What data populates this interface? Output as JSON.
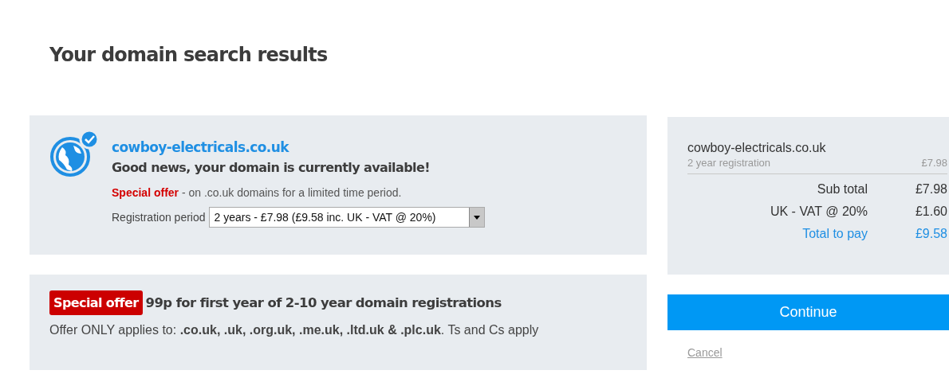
{
  "title": "Your domain search results",
  "result": {
    "domain": "cowboy-electricals.co.uk",
    "headline": "Good news, your domain is currently available!",
    "offer_label": "Special offer",
    "offer_text": " - on .co.uk domains for a limited time period.",
    "period_label": "Registration period",
    "period_value": "2 years - £7.98 (£9.58 inc. UK - VAT @ 20%)"
  },
  "promo": {
    "badge": "Special offer",
    "headline": "99p for first year of 2-10 year domain registrations",
    "note": "Offer ONLY applies to: **.co.uk, .uk, .org.uk, .me.uk, .ltd.uk & .plc.uk**. Ts and Cs apply"
  },
  "summary": {
    "item": "cowboy-electricals.co.uk",
    "item_detail": "2 year registration",
    "item_price": "£7.98",
    "rows": [
      {
        "kind": "line",
        "label": "Sub total",
        "amount": "£7.98"
      },
      {
        "kind": "line",
        "label": "UK - VAT @ 20%",
        "amount": "£1.60"
      },
      {
        "kind": "total",
        "label": "Total to pay",
        "amount": "£9.58"
      }
    ]
  },
  "continue_button": "Continue",
  "cancel_link": "Cancel"
}
